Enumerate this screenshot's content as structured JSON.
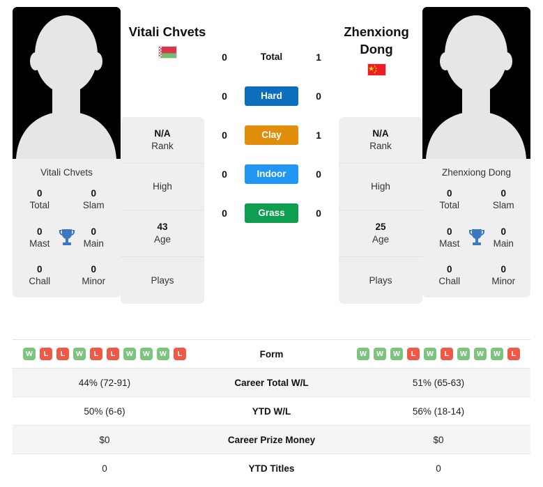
{
  "players": {
    "left": {
      "name": "Vitali Chvets",
      "card_name": "Vitali Chvets",
      "flag": "belarus-flag",
      "rank": "N/A",
      "rank_label": "Rank",
      "high_label": "High",
      "high_value": "",
      "age": "43",
      "age_label": "Age",
      "plays_label": "Plays",
      "plays_value": "",
      "titles": {
        "total": "0",
        "total_label": "Total",
        "slam": "0",
        "slam_label": "Slam",
        "mast": "0",
        "mast_label": "Mast",
        "main": "0",
        "main_label": "Main",
        "chall": "0",
        "chall_label": "Chall",
        "minor": "0",
        "minor_label": "Minor"
      },
      "form": [
        "W",
        "L",
        "L",
        "W",
        "L",
        "L",
        "W",
        "W",
        "W",
        "L"
      ],
      "career_wl": "44% (72-91)",
      "ytd_wl": "50% (6-6)",
      "prize_money": "$0",
      "ytd_titles": "0"
    },
    "right": {
      "name": "Zhenxiong Dong",
      "card_name": "Zhenxiong Dong",
      "flag": "china-flag",
      "rank": "N/A",
      "rank_label": "Rank",
      "high_label": "High",
      "high_value": "",
      "age": "25",
      "age_label": "Age",
      "plays_label": "Plays",
      "plays_value": "",
      "titles": {
        "total": "0",
        "total_label": "Total",
        "slam": "0",
        "slam_label": "Slam",
        "mast": "0",
        "mast_label": "Mast",
        "main": "0",
        "main_label": "Main",
        "chall": "0",
        "chall_label": "Chall",
        "minor": "0",
        "minor_label": "Minor"
      },
      "form": [
        "W",
        "W",
        "W",
        "L",
        "W",
        "L",
        "W",
        "W",
        "W",
        "L"
      ],
      "career_wl": "51% (65-63)",
      "ytd_wl": "56% (18-14)",
      "prize_money": "$0",
      "ytd_titles": "0"
    }
  },
  "h2h": {
    "rows": [
      {
        "label": "Total",
        "left": "0",
        "right": "1",
        "color": "",
        "style": "plain"
      },
      {
        "label": "Hard",
        "left": "0",
        "right": "0",
        "color": "#0d6ebd",
        "style": "tinted"
      },
      {
        "label": "Clay",
        "left": "0",
        "right": "1",
        "color": "#e08e0b",
        "style": "tinted"
      },
      {
        "label": "Indoor",
        "left": "0",
        "right": "0",
        "color": "#2196f3",
        "style": "tinted"
      },
      {
        "label": "Grass",
        "left": "0",
        "right": "0",
        "color": "#0f9d4f",
        "style": "tinted"
      }
    ]
  },
  "comparison": {
    "rows": [
      {
        "label": "Form",
        "type": "form"
      },
      {
        "label": "Career Total W/L",
        "type": "text",
        "key": "career_wl"
      },
      {
        "label": "YTD W/L",
        "type": "text",
        "key": "ytd_wl"
      },
      {
        "label": "Career Prize Money",
        "type": "text",
        "key": "prize_money"
      },
      {
        "label": "YTD Titles",
        "type": "text",
        "key": "ytd_titles"
      }
    ]
  },
  "colors": {
    "hard": "#0d6ebd",
    "clay": "#e08e0b",
    "indoor": "#2196f3",
    "grass": "#0f9d4f",
    "win": "#7cc47f",
    "loss": "#ef5a46",
    "card_bg": "#efefef",
    "alt_row": "#f5f5f5"
  }
}
